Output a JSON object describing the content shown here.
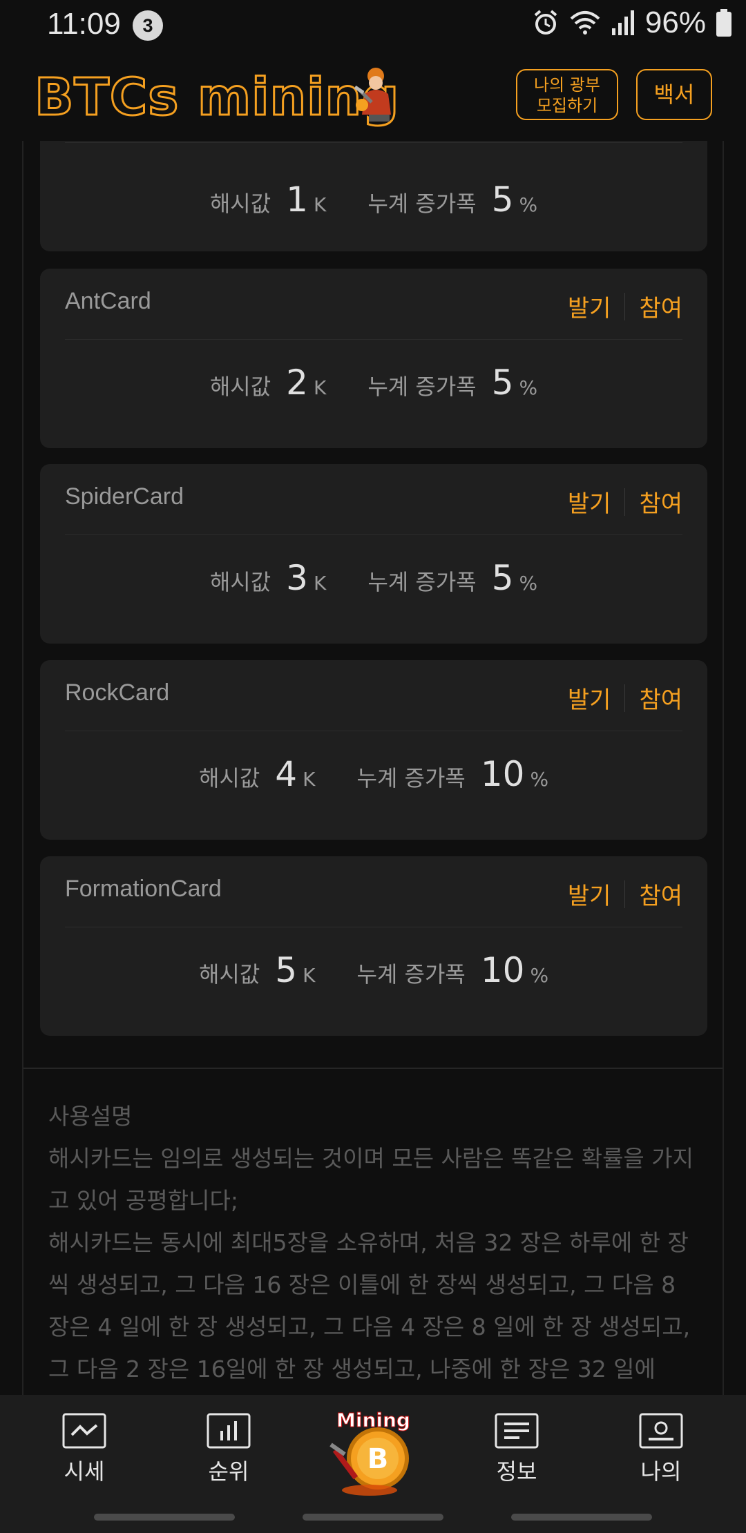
{
  "status_bar": {
    "time": "11:09",
    "notification_count": "3",
    "battery": "96%"
  },
  "header": {
    "logo_text": "BTCs mining",
    "study_button": "나의 광부\n모집하기",
    "whitepaper_button": "백서"
  },
  "cards": [
    {
      "name": "",
      "hash_label": "해시값",
      "hash_value": "1",
      "hash_unit": "K",
      "growth_label": "누계 증가폭",
      "growth_value": "5",
      "growth_unit": "%"
    },
    {
      "name": "AntCard",
      "issue": "발기",
      "join": "참여",
      "hash_label": "해시값",
      "hash_value": "2",
      "hash_unit": "K",
      "growth_label": "누계 증가폭",
      "growth_value": "5",
      "growth_unit": "%"
    },
    {
      "name": "SpiderCard",
      "issue": "발기",
      "join": "참여",
      "hash_label": "해시값",
      "hash_value": "3",
      "hash_unit": "K",
      "growth_label": "누계 증가폭",
      "growth_value": "5",
      "growth_unit": "%"
    },
    {
      "name": "RockCard",
      "issue": "발기",
      "join": "참여",
      "hash_label": "해시값",
      "hash_value": "4",
      "hash_unit": "K",
      "growth_label": "누계 증가폭",
      "growth_value": "10",
      "growth_unit": "%"
    },
    {
      "name": "FormationCard",
      "issue": "발기",
      "join": "참여",
      "hash_label": "해시값",
      "hash_value": "5",
      "hash_unit": "K",
      "growth_label": "누계 증가폭",
      "growth_value": "10",
      "growth_unit": "%"
    }
  ],
  "instructions": {
    "title": "사용설명",
    "para1": "해시카드는 임의로 생성되는 것이며 모든 사람은 똑같은 확률을 가지고 있어 공평합니다;",
    "para2": "해시카드는 동시에 최대5장을 소유하며, 처음 32 장은 하루에 한 장씩 생성되고, 그 다음 16 장은 이틀에 한 장씩 생성되고, 그 다음 8 장은 4 일에 한 장 생성되고, 그 다음 4 장은 8 일에 한 장 생성되고, 그 다음 2 장은 16일에 한 장 생성되고, 나중에 한 장은 32 일에"
  },
  "bottom_nav": {
    "market": "시세",
    "ranking": "순위",
    "mining": "Mining",
    "info": "정보",
    "mine": "나의"
  },
  "colors": {
    "accent": "#f5a020",
    "background": "#0f0f0f",
    "card": "#1f1f1f"
  }
}
